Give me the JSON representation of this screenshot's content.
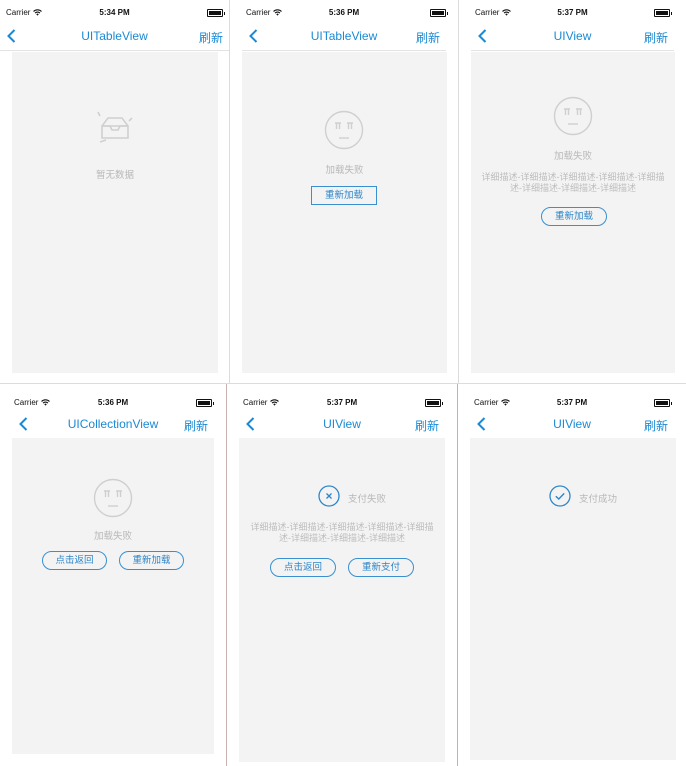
{
  "status_bar": {
    "carrier": "Carrier",
    "times": [
      "5:34 PM",
      "5:36 PM",
      "5:37 PM",
      "5:36 PM",
      "5:37 PM",
      "5:37 PM"
    ]
  },
  "nav": {
    "titles": [
      "UITableView",
      "UITableView",
      "UIView",
      "UICollectionView",
      "UIView",
      "UIView"
    ],
    "right_label": "刷新",
    "back_icon": "chevron-left-icon"
  },
  "screens": {
    "s1": {
      "message": "暂无数据",
      "icon": "empty-box-icon"
    },
    "s2": {
      "message": "加载失败",
      "icon": "sad-face-icon",
      "reload_button": "重新加载"
    },
    "s3": {
      "message": "加载失败",
      "icon": "sad-face-icon",
      "detail": "详细描述-详细描述-详细描述-详细描述-详细描述-详细描述-详细描述-详细描述",
      "reload_button": "重新加载"
    },
    "s4": {
      "message": "加载失败",
      "icon": "sad-face-icon",
      "back_button": "点击返回",
      "reload_button": "重新加载"
    },
    "s5": {
      "message": "支付失败",
      "icon": "close-circle-icon",
      "detail": "详细描述-详细描述-详细描述-详细描述-详细描述-详细描述-详细描述-详细描述",
      "back_button": "点击返回",
      "pay_button": "重新支付"
    },
    "s6": {
      "message": "支付成功",
      "icon": "check-circle-icon"
    }
  },
  "colors": {
    "accent": "#1a8ad4",
    "content_bg": "#f3f3f3",
    "muted_text": "#b8b8b8"
  }
}
